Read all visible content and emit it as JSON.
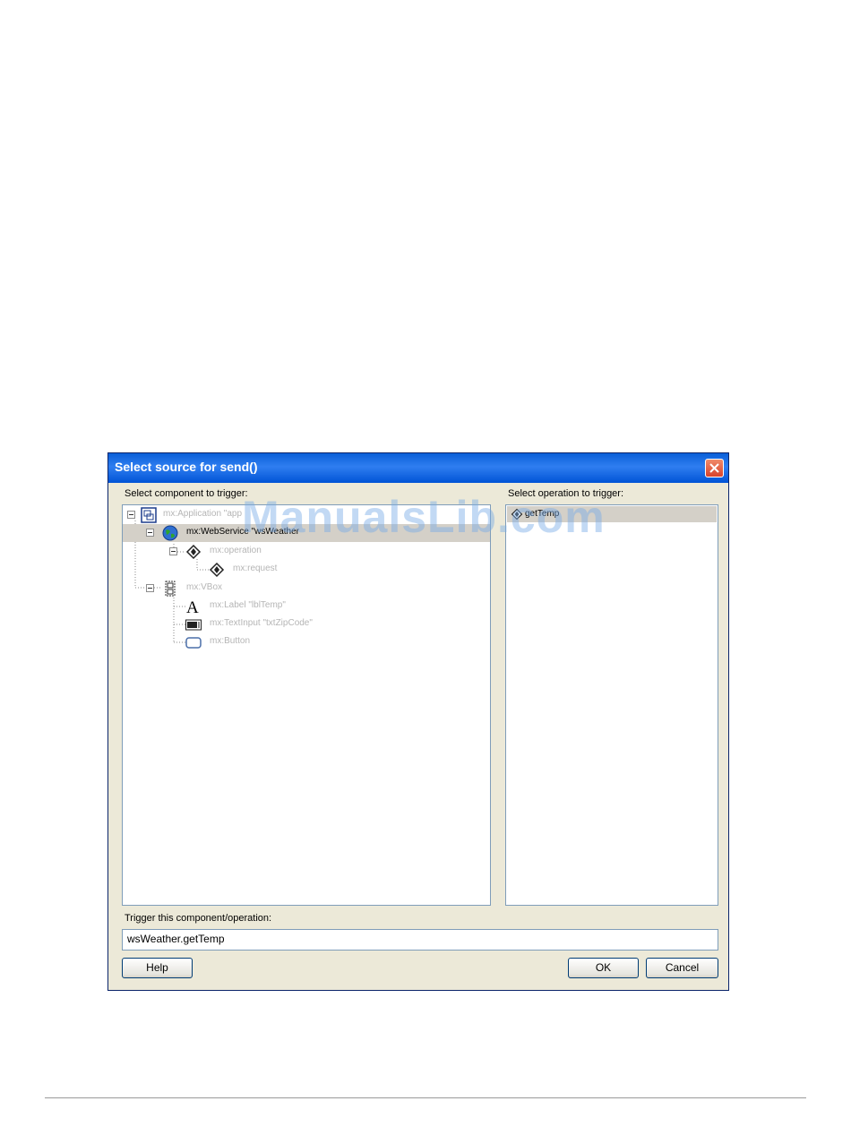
{
  "dialog": {
    "title": "Select source for send()",
    "component_label": "Select component to trigger:",
    "operation_label": "Select operation to trigger:",
    "trigger_label": "Trigger this component/operation:",
    "trigger_value": "wsWeather.getTemp",
    "help_label": "Help",
    "ok_label": "OK",
    "cancel_label": "Cancel"
  },
  "tree": [
    {
      "label": "mx:Application \"app",
      "icon": "application-icon",
      "selected": false
    },
    {
      "label": "mx:WebService \"wsWeather",
      "icon": "globe-icon",
      "selected": true
    },
    {
      "label": "mx:operation",
      "icon": "diamond-icon",
      "selected": false
    },
    {
      "label": "mx:request",
      "icon": "diamond-icon",
      "selected": false
    },
    {
      "label": "mx:VBox",
      "icon": "vbox-icon",
      "selected": false
    },
    {
      "label": "mx:Label \"lblTemp\"",
      "icon": "label-a-icon",
      "selected": false
    },
    {
      "label": "mx:TextInput \"txtZipCode\"",
      "icon": "textinput-icon",
      "selected": false
    },
    {
      "label": "mx:Button",
      "icon": "button-icon",
      "selected": false
    }
  ],
  "operations": [
    {
      "label": "getTemp",
      "icon": "diamond-icon",
      "selected": true
    }
  ],
  "watermark": "ManualsLib.com",
  "colors": {
    "titlebar": "#0a5fd8",
    "dialog_bg": "#ece9d8",
    "selection": "#d4d0c8"
  }
}
